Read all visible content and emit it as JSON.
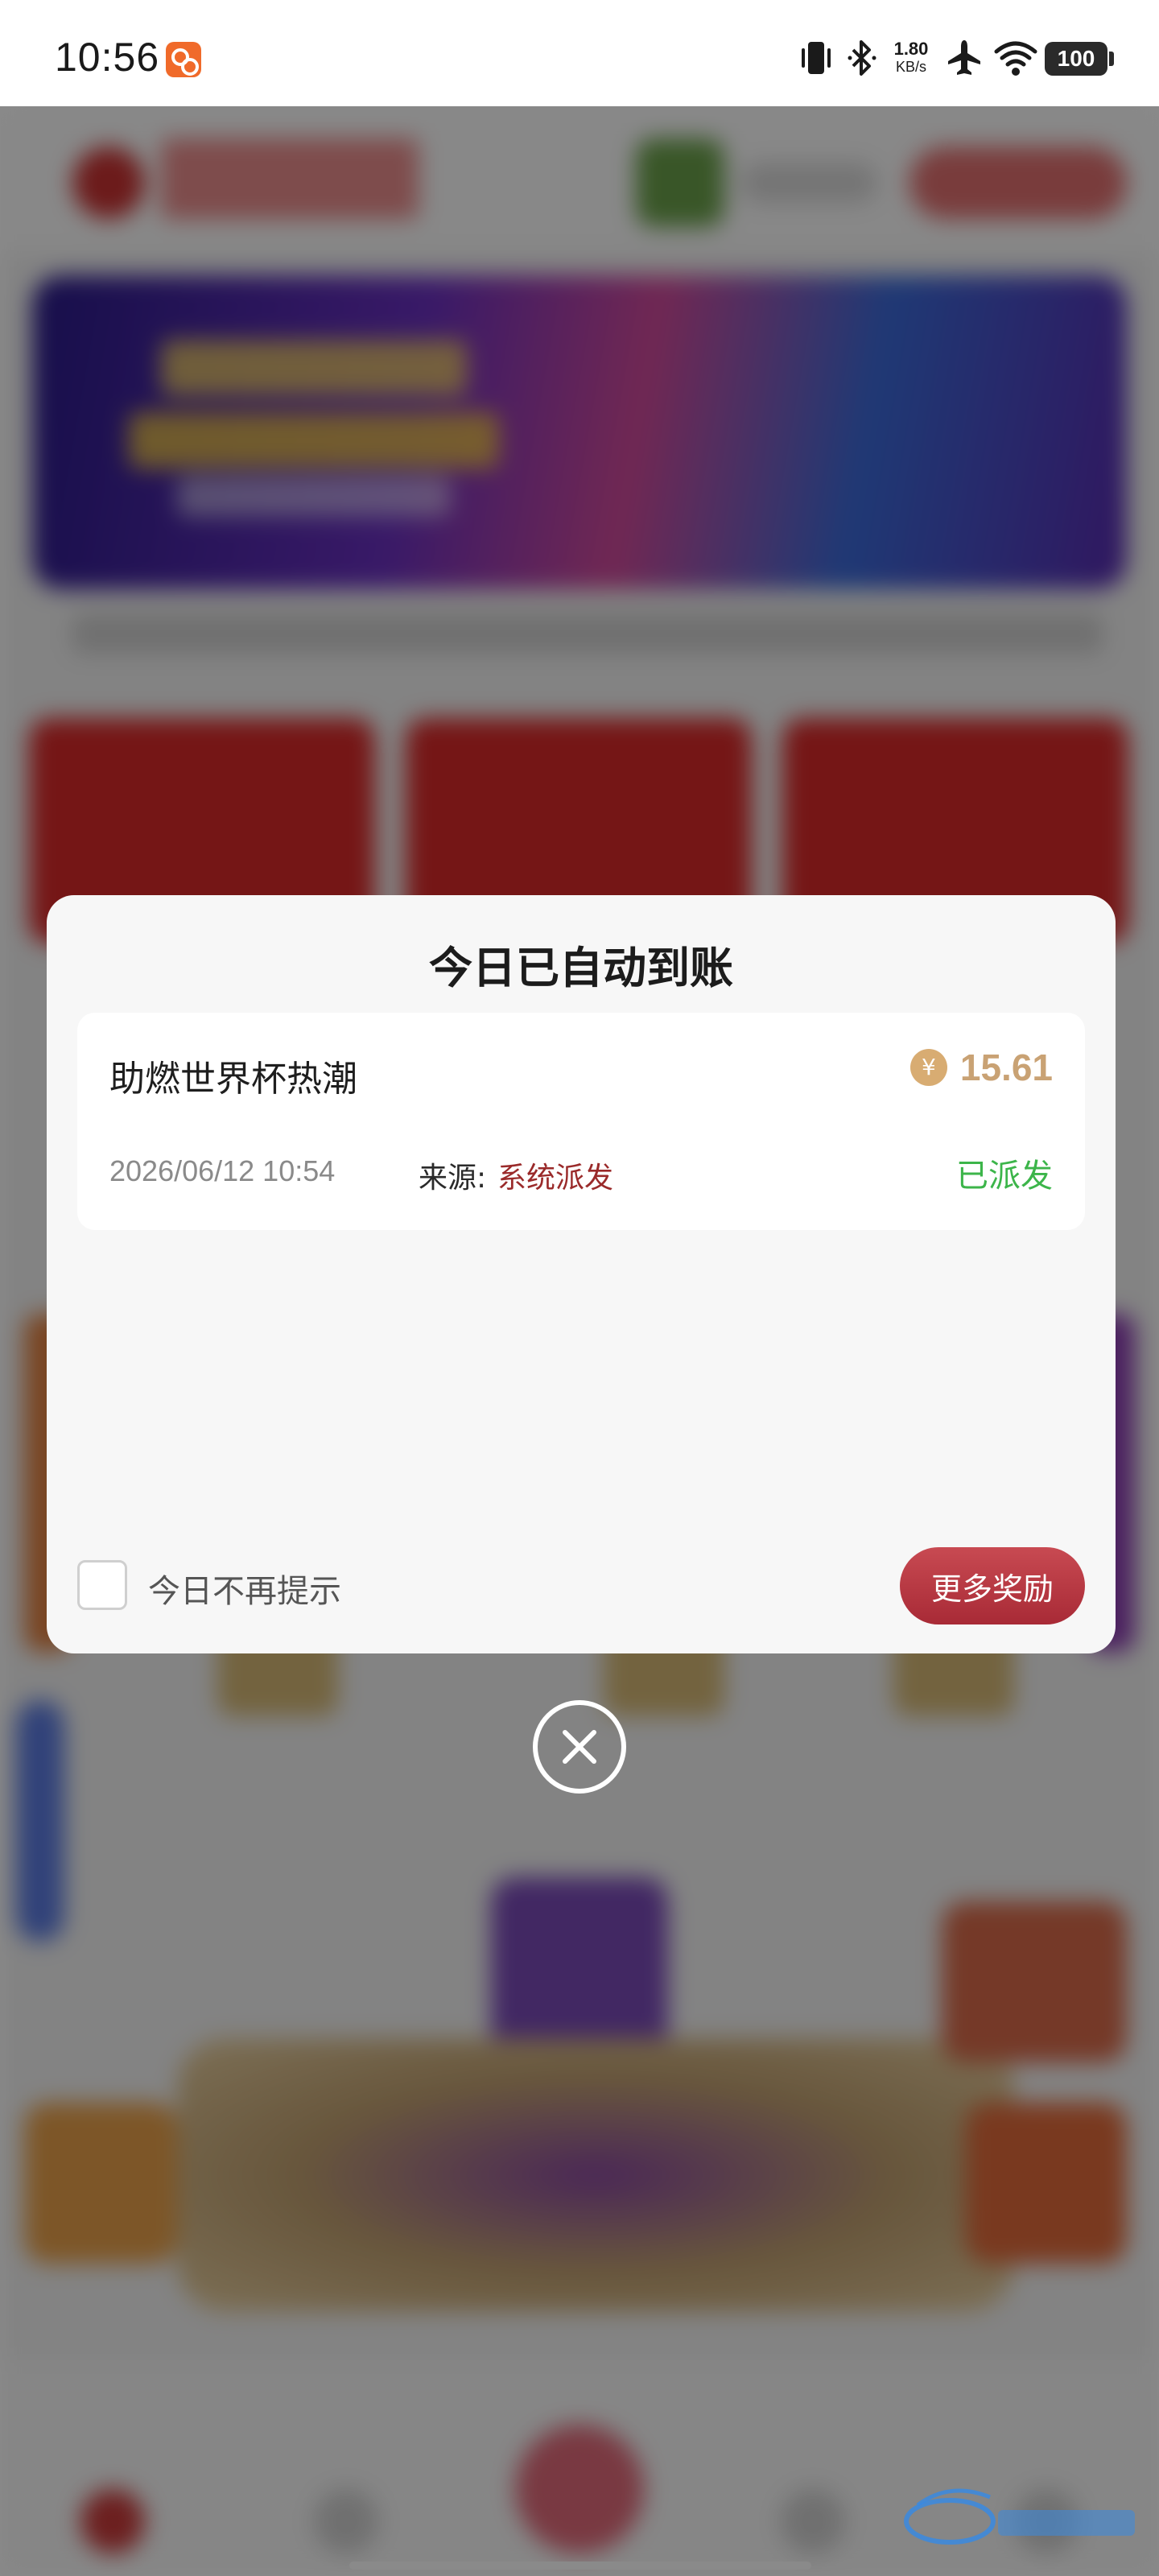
{
  "status_bar": {
    "time": "10:56",
    "net_speed_value": "1.80",
    "net_speed_unit": "KB/s",
    "battery": "100",
    "icons": [
      "app-notification-icon",
      "vibrate-icon",
      "bluetooth-icon",
      "airplane-icon",
      "wifi-icon",
      "battery-icon"
    ]
  },
  "dialog": {
    "title": "今日已自动到账",
    "reward": {
      "name": "助燃世界杯热潮",
      "amount": "15.61",
      "currency_symbol": "¥",
      "time": "2026/06/12 10:54",
      "source_label": "来源:",
      "source_value": "系统派发",
      "status": "已派发"
    },
    "dont_show_label": "今日不再提示",
    "more_button": "更多奖励"
  },
  "colors": {
    "amount": "#c9a274",
    "status_green": "#3cb54a",
    "source_red": "#9a2a2a",
    "button_red": "#b83a44"
  }
}
